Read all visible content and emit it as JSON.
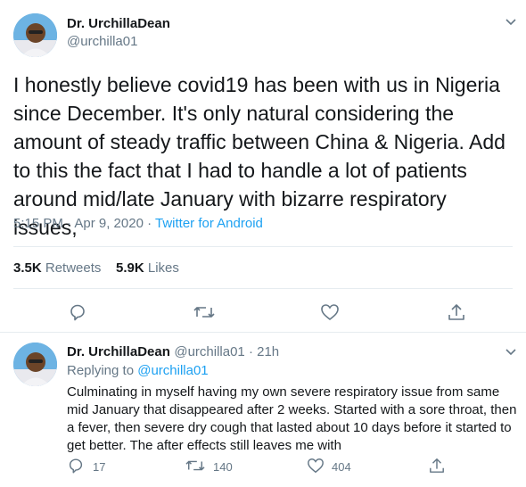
{
  "tweet": {
    "display_name": "Dr. UrchillaDean",
    "handle": "@urchilla01",
    "text": "I honestly believe covid19 has been with us in Nigeria since December. It's only natural considering the amount of steady traffic between China & Nigeria. Add to this the fact that I had to handle a lot of patients around mid/late January with bizarre respiratory issues,",
    "time": "5:15 PM · Apr 9, 2020 · ",
    "source": "Twitter for Android",
    "retweets_count": "3.5K",
    "retweets_label": "Retweets",
    "likes_count": "5.9K",
    "likes_label": "Likes"
  },
  "reply": {
    "display_name": "Dr. UrchillaDean",
    "handle_time": "@urchilla01 · 21h",
    "replying_to_label": "Replying to",
    "replying_to_handle": "@urchilla01",
    "text": "Culminating in myself having my own severe respiratory issue from same mid January that disappeared after 2 weeks. Started with a sore throat, then a fever, then severe dry cough that lasted about 10 days before it started to get better. The after effects still leaves me with",
    "reply_count": "17",
    "retweet_count": "140",
    "like_count": "404"
  },
  "icons": {
    "more": "chevron-down-icon",
    "reply": "reply-icon",
    "retweet": "retweet-icon",
    "like": "heart-icon",
    "share": "share-icon"
  },
  "colors": {
    "link": "#1da1f2",
    "secondary_text": "#657786",
    "divider": "#e6ecf0"
  }
}
